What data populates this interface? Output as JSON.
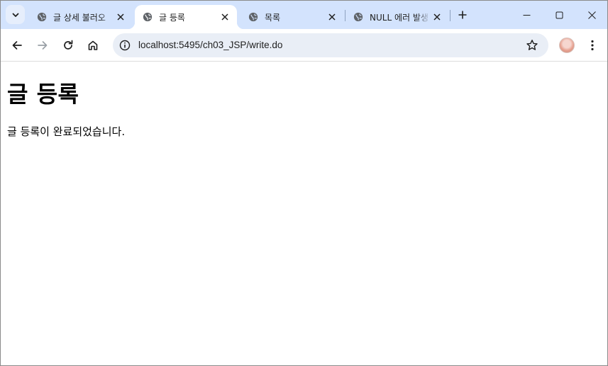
{
  "browser": {
    "tabs": [
      {
        "title": "글 상세 불러오",
        "active": false,
        "icon": "globe-icon"
      },
      {
        "title": "글 등록",
        "active": true,
        "icon": "globe-icon"
      },
      {
        "title": "목록",
        "active": false,
        "icon": "globe-icon"
      },
      {
        "title": "NULL 에러 발생",
        "active": false,
        "icon": "globe-icon"
      }
    ],
    "address": "localhost:5495/ch03_JSP/write.do",
    "accent_color": "#d3e3fd"
  },
  "page": {
    "heading": "글 등록",
    "message": "글 등록이 완료되었습니다."
  }
}
